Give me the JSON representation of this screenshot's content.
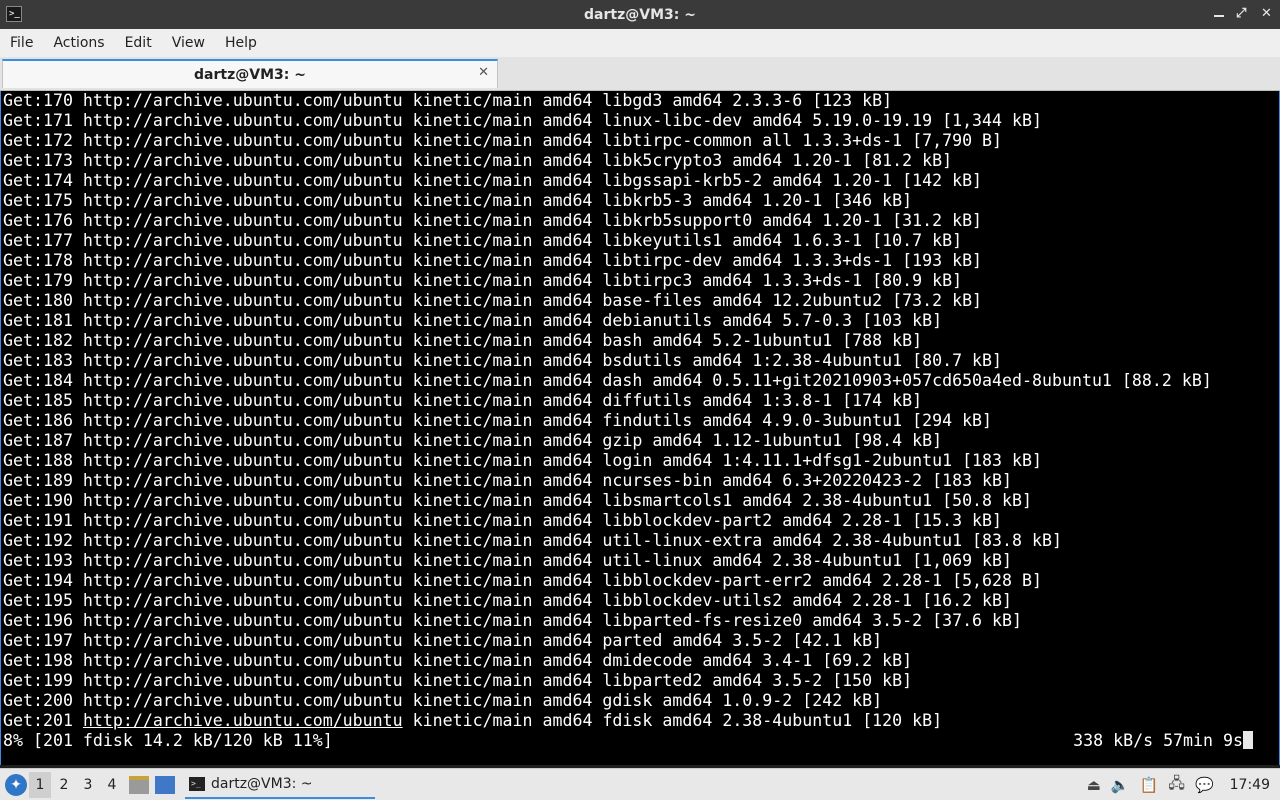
{
  "window": {
    "title": "dartz@VM3: ~"
  },
  "menu": [
    "File",
    "Actions",
    "Edit",
    "View",
    "Help"
  ],
  "tab": {
    "label": "dartz@VM3: ~",
    "close_glyph": "✕"
  },
  "terminal": {
    "lines": [
      "Get:170 http://archive.ubuntu.com/ubuntu kinetic/main amd64 libgd3 amd64 2.3.3-6 [123 kB]",
      "Get:171 http://archive.ubuntu.com/ubuntu kinetic/main amd64 linux-libc-dev amd64 5.19.0-19.19 [1,344 kB]",
      "Get:172 http://archive.ubuntu.com/ubuntu kinetic/main amd64 libtirpc-common all 1.3.3+ds-1 [7,790 B]",
      "Get:173 http://archive.ubuntu.com/ubuntu kinetic/main amd64 libk5crypto3 amd64 1.20-1 [81.2 kB]",
      "Get:174 http://archive.ubuntu.com/ubuntu kinetic/main amd64 libgssapi-krb5-2 amd64 1.20-1 [142 kB]",
      "Get:175 http://archive.ubuntu.com/ubuntu kinetic/main amd64 libkrb5-3 amd64 1.20-1 [346 kB]",
      "Get:176 http://archive.ubuntu.com/ubuntu kinetic/main amd64 libkrb5support0 amd64 1.20-1 [31.2 kB]",
      "Get:177 http://archive.ubuntu.com/ubuntu kinetic/main amd64 libkeyutils1 amd64 1.6.3-1 [10.7 kB]",
      "Get:178 http://archive.ubuntu.com/ubuntu kinetic/main amd64 libtirpc-dev amd64 1.3.3+ds-1 [193 kB]",
      "Get:179 http://archive.ubuntu.com/ubuntu kinetic/main amd64 libtirpc3 amd64 1.3.3+ds-1 [80.9 kB]",
      "Get:180 http://archive.ubuntu.com/ubuntu kinetic/main amd64 base-files amd64 12.2ubuntu2 [73.2 kB]",
      "Get:181 http://archive.ubuntu.com/ubuntu kinetic/main amd64 debianutils amd64 5.7-0.3 [103 kB]",
      "Get:182 http://archive.ubuntu.com/ubuntu kinetic/main amd64 bash amd64 5.2-1ubuntu1 [788 kB]",
      "Get:183 http://archive.ubuntu.com/ubuntu kinetic/main amd64 bsdutils amd64 1:2.38-4ubuntu1 [80.7 kB]",
      "Get:184 http://archive.ubuntu.com/ubuntu kinetic/main amd64 dash amd64 0.5.11+git20210903+057cd650a4ed-8ubuntu1 [88.2 kB]",
      "Get:185 http://archive.ubuntu.com/ubuntu kinetic/main amd64 diffutils amd64 1:3.8-1 [174 kB]",
      "Get:186 http://archive.ubuntu.com/ubuntu kinetic/main amd64 findutils amd64 4.9.0-3ubuntu1 [294 kB]",
      "Get:187 http://archive.ubuntu.com/ubuntu kinetic/main amd64 gzip amd64 1.12-1ubuntu1 [98.4 kB]",
      "Get:188 http://archive.ubuntu.com/ubuntu kinetic/main amd64 login amd64 1:4.11.1+dfsg1-2ubuntu1 [183 kB]",
      "Get:189 http://archive.ubuntu.com/ubuntu kinetic/main amd64 ncurses-bin amd64 6.3+20220423-2 [183 kB]",
      "Get:190 http://archive.ubuntu.com/ubuntu kinetic/main amd64 libsmartcols1 amd64 2.38-4ubuntu1 [50.8 kB]",
      "Get:191 http://archive.ubuntu.com/ubuntu kinetic/main amd64 libblockdev-part2 amd64 2.28-1 [15.3 kB]",
      "Get:192 http://archive.ubuntu.com/ubuntu kinetic/main amd64 util-linux-extra amd64 2.38-4ubuntu1 [83.8 kB]",
      "Get:193 http://archive.ubuntu.com/ubuntu kinetic/main amd64 util-linux amd64 2.38-4ubuntu1 [1,069 kB]",
      "Get:194 http://archive.ubuntu.com/ubuntu kinetic/main amd64 libblockdev-part-err2 amd64 2.28-1 [5,628 B]",
      "Get:195 http://archive.ubuntu.com/ubuntu kinetic/main amd64 libblockdev-utils2 amd64 2.28-1 [16.2 kB]",
      "Get:196 http://archive.ubuntu.com/ubuntu kinetic/main amd64 libparted-fs-resize0 amd64 3.5-2 [37.6 kB]",
      "Get:197 http://archive.ubuntu.com/ubuntu kinetic/main amd64 parted amd64 3.5-2 [42.1 kB]",
      "Get:198 http://archive.ubuntu.com/ubuntu kinetic/main amd64 dmidecode amd64 3.4-1 [69.2 kB]",
      "Get:199 http://archive.ubuntu.com/ubuntu kinetic/main amd64 libparted2 amd64 3.5-2 [150 kB]",
      "Get:200 http://archive.ubuntu.com/ubuntu kinetic/main amd64 gdisk amd64 1.0.9-2 [242 kB]"
    ],
    "last_line": {
      "prefix": "Get:201 ",
      "url": "http://archive.ubuntu.com/ubuntu",
      "rest": " kinetic/main amd64 fdisk amd64 2.38-4ubuntu1 [120 kB]"
    },
    "progress_left": "8% [201 fdisk 14.2 kB/120 kB 11%]",
    "progress_right": "338 kB/s 57min 9s"
  },
  "taskbar": {
    "workspaces": [
      "1",
      "2",
      "3",
      "4"
    ],
    "active_workspace": "1",
    "window_label": "dartz@VM3: ~",
    "clock": "17:49"
  },
  "colors": {
    "accent": "#3a8de0",
    "terminal_bg": "#000000",
    "terminal_fg": "#ffffff"
  }
}
